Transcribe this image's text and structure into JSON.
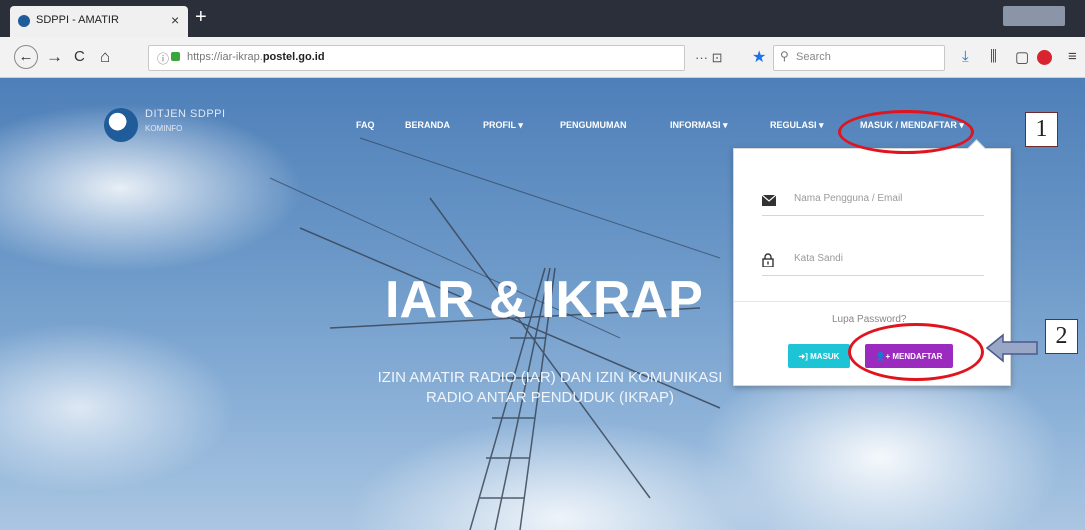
{
  "browser": {
    "tab_title": "SDPPI - AMATIR",
    "tab_close": "×",
    "new_tab": "+",
    "tabbar_faded": "",
    "back": "←",
    "forward": "→",
    "reload": "C",
    "home": "⌂",
    "url_prefix": "https://iar-ikrap.",
    "url_domain": "postel.go.id",
    "page_actions": "··· ⊡",
    "search_placeholder": "Search"
  },
  "site": {
    "logo_line1": "DITJEN SDPPI",
    "logo_line2": "KOMINFO",
    "nav": [
      {
        "label": "FAQ"
      },
      {
        "label": "BERANDA"
      },
      {
        "label": "PROFIL ▾"
      },
      {
        "label": "PENGUMUMAN"
      },
      {
        "label": "INFORMASI ▾"
      },
      {
        "label": "REGULASI ▾"
      },
      {
        "label": "MASUK / MENDAFTAR ▾"
      }
    ],
    "hero_title": "IAR & IKRAP",
    "hero_subtitle": "IZIN AMATIR RADIO (IAR) DAN IZIN KOMUNIKASI RADIO ANTAR PENDUDUK (IKRAP)"
  },
  "login_dropdown": {
    "username_placeholder": "Nama Pengguna / Email",
    "password_placeholder": "Kata Sandi",
    "forgot_link": "Lupa Password?",
    "login_button": "MASUK",
    "register_button": "MENDAFTAR"
  },
  "annotations": {
    "step1": "1",
    "step2": "2"
  },
  "colors": {
    "login_button": "#1cc4d6",
    "register_button": "#9b2bbf",
    "annotation_red": "#e0141e"
  }
}
